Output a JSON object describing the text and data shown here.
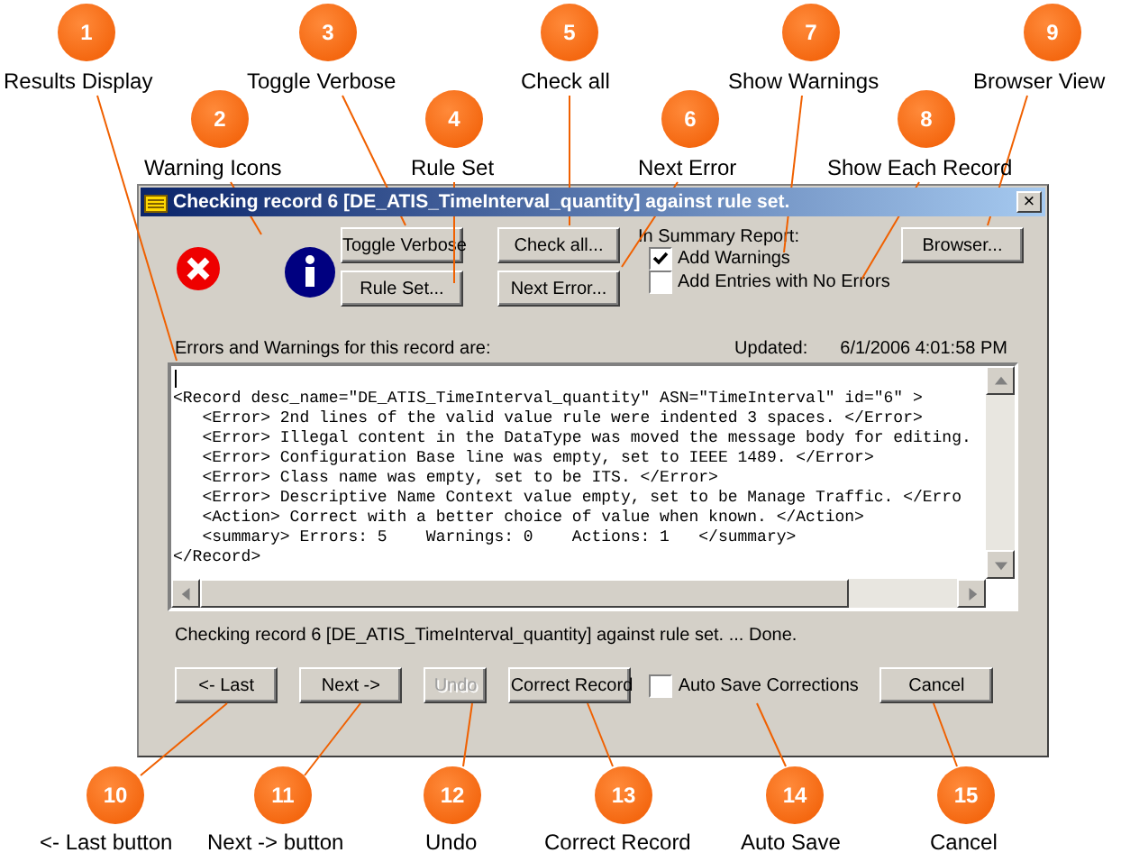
{
  "callouts_top": [
    {
      "number": "1",
      "label": "Results Display"
    },
    {
      "number": "3",
      "label": "Toggle Verbose"
    },
    {
      "number": "5",
      "label": "Check all"
    },
    {
      "number": "7",
      "label": "Show Warnings"
    },
    {
      "number": "9",
      "label": "Browser View"
    },
    {
      "number": "2",
      "label": "Warning Icons"
    },
    {
      "number": "4",
      "label": "Rule Set"
    },
    {
      "number": "6",
      "label": "Next Error"
    },
    {
      "number": "8",
      "label": "Show Each Record"
    }
  ],
  "window": {
    "title": "Checking record 6 [DE_ATIS_TimeInterval_quantity] against rule set.",
    "close": "×"
  },
  "toolbar": {
    "buttons": [
      {
        "label": "Toggle Verbose"
      },
      {
        "label": "Rule Set..."
      },
      {
        "label": "Check all..."
      },
      {
        "label": "Next Error..."
      }
    ],
    "summary": {
      "heading": "In Summary Report:",
      "options": [
        {
          "label": "Add Warnings",
          "checked": true
        },
        {
          "label": "Add Entries with No Errors",
          "checked": false
        }
      ]
    },
    "browser_button": "Browser..."
  },
  "results": {
    "heading": "Errors and Warnings for this record are:",
    "updated_label": "Updated:",
    "updated": "6/1/2006 4:01:58 PM",
    "lines": [
      "<Record desc_name=\"DE_ATIS_TimeInterval_quantity\" ASN=\"TimeInterval\" id=\"6\" >",
      "   <Error> 2nd lines of the valid value rule were indented 3 spaces. </Error>",
      "   <Error> Illegal content in the DataType was moved the message body for editing.",
      "   <Error> Configuration Base line was empty, set to IEEE 1489. </Error>",
      "   <Error> Class name was empty, set to be ITS. </Error>",
      "   <Error> Descriptive Name Context value empty, set to be Manage Traffic. </Erro",
      "   <Action> Correct with a better choice of value when known. </Action>",
      "   <summary> Errors: 5    Warnings: 0    Actions: 1   </summary>",
      "</Record>"
    ]
  },
  "status": "Checking record 6 [DE_ATIS_TimeInterval_quantity] against rule set. ... Done.",
  "bottom_buttons": [
    {
      "kind": "button",
      "label": "<- Last",
      "disabled": false
    },
    {
      "kind": "button",
      "label": "Next ->",
      "disabled": false
    },
    {
      "kind": "button",
      "label": "Undo",
      "disabled": true
    },
    {
      "kind": "button",
      "label": "Correct Record",
      "disabled": false
    },
    {
      "kind": "checkbox",
      "label": "Auto Save Corrections",
      "checked": false
    },
    {
      "kind": "cancel",
      "label": "Cancel",
      "disabled": false
    }
  ],
  "callouts_bottom": [
    {
      "number": "10",
      "label": "<- Last button"
    },
    {
      "number": "11",
      "label": "Next -> button"
    },
    {
      "number": "12",
      "label": "Undo"
    },
    {
      "number": "13",
      "label": "Correct Record"
    },
    {
      "number": "14",
      "label": "Auto Save"
    },
    {
      "number": "15",
      "label": "Cancel"
    }
  ]
}
